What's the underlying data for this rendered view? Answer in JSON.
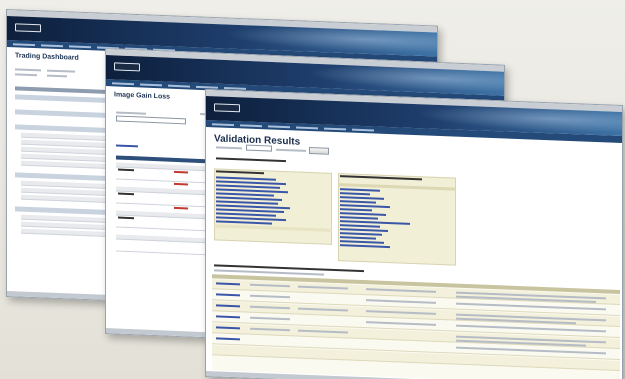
{
  "windows": {
    "trading": {
      "title": "Trading Dashboard"
    },
    "gains": {
      "title": "Image Gain Loss"
    },
    "validation": {
      "title": "Validation Results"
    }
  },
  "colors": {
    "banner_dark": "#0d1f3c",
    "banner_light": "#3e73a6",
    "link": "#3a56a8",
    "highlight_row": "#f1efd6",
    "error_text": "#c0392b"
  },
  "icons": {
    "logo": "app-logo-icon",
    "dropdown": "chevron-down-icon"
  }
}
